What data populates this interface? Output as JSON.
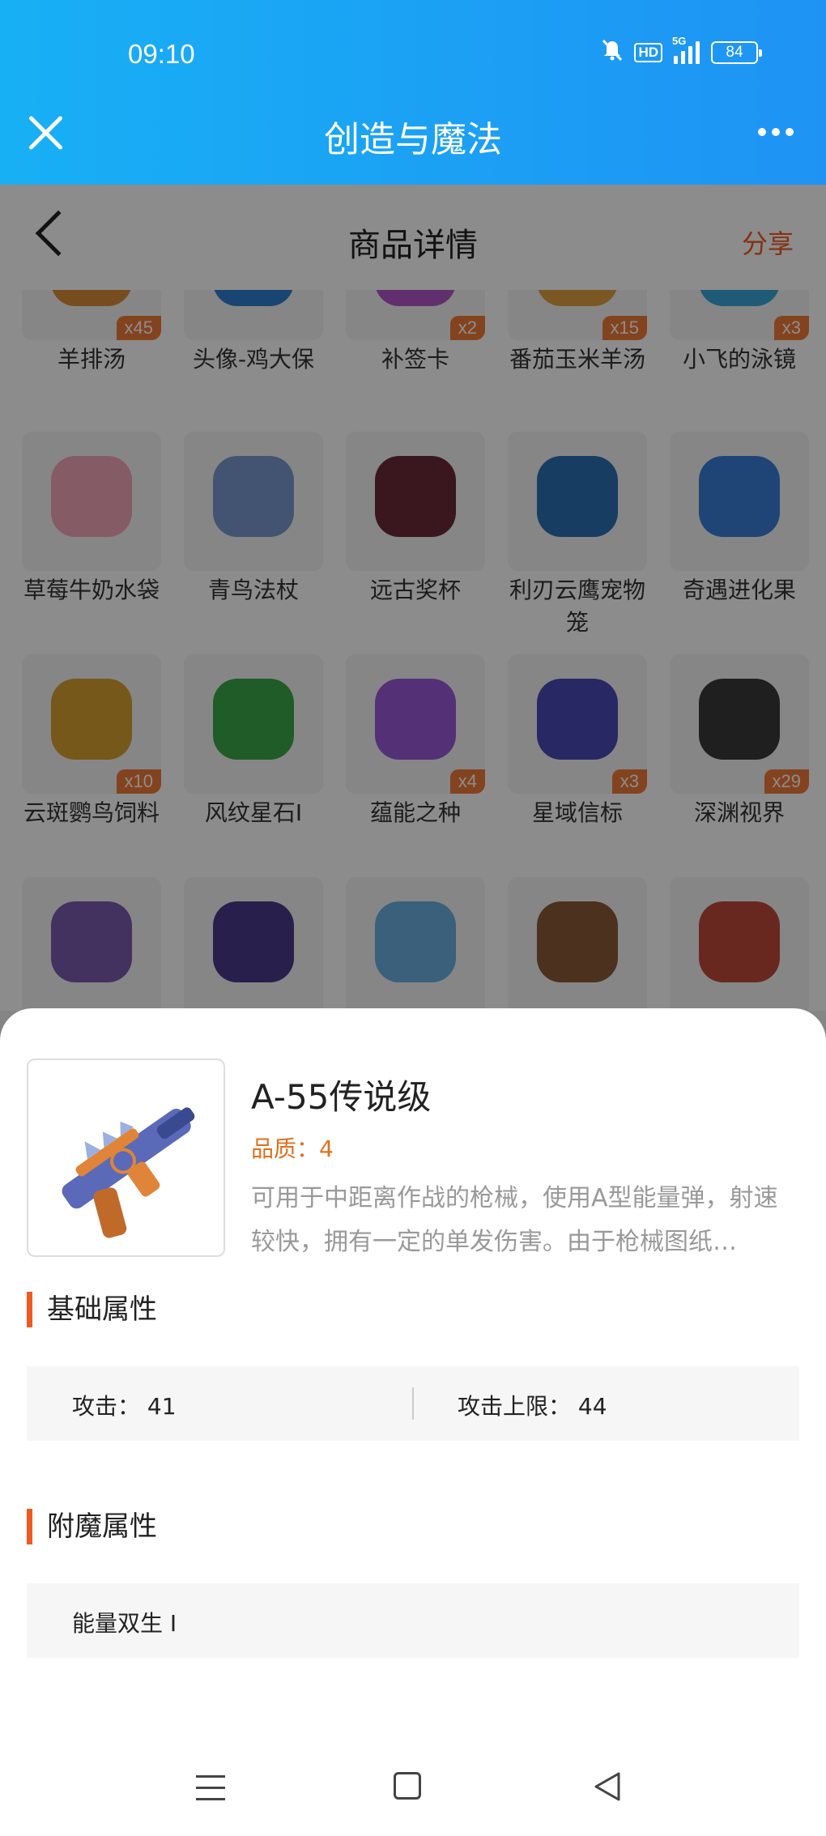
{
  "status_bar": {
    "time": "09:10",
    "hd": "HD",
    "network": "5G",
    "battery": "84"
  },
  "app_bar": {
    "title": "创造与魔法"
  },
  "page_header": {
    "title": "商品详情",
    "share": "分享"
  },
  "grid": {
    "items": [
      {
        "name": "羊排汤",
        "count": "x45",
        "color": "#d98b3a"
      },
      {
        "name": "头像-鸡大保",
        "count": "",
        "color": "#2e7fd0"
      },
      {
        "name": "补签卡",
        "count": "x2",
        "color": "#b357c9"
      },
      {
        "name": "番茄玉米羊汤",
        "count": "x15",
        "color": "#e0a040"
      },
      {
        "name": "小飞的泳镜",
        "count": "x3",
        "color": "#3aa6d8"
      },
      {
        "name": "草莓牛奶水袋",
        "count": "",
        "color": "#f3a6b8"
      },
      {
        "name": "青鸟法杖",
        "count": "",
        "color": "#7a9ad0"
      },
      {
        "name": "远古奖杯",
        "count": "",
        "color": "#6b2a3a"
      },
      {
        "name": "利刃云鹰宠物笼",
        "count": "",
        "color": "#2d6fb5"
      },
      {
        "name": "奇遇进化果",
        "count": "",
        "color": "#3a7dd8"
      },
      {
        "name": "云斑鹦鸟饲料",
        "count": "x10",
        "color": "#d8a030"
      },
      {
        "name": "风纹星石I",
        "count": "",
        "color": "#3aa84a"
      },
      {
        "name": "蕴能之种",
        "count": "x4",
        "color": "#9a5ad8"
      },
      {
        "name": "星域信标",
        "count": "x3",
        "color": "#4a4ab8"
      },
      {
        "name": "深渊视界",
        "count": "x29",
        "color": "#3a3a3a"
      },
      {
        "name": "",
        "count": "",
        "color": "#7a5ab0"
      },
      {
        "name": "",
        "count": "",
        "color": "#4a3a8a"
      },
      {
        "name": "",
        "count": "",
        "color": "#6ab0e0"
      },
      {
        "name": "",
        "count": "",
        "color": "#8a5a3a"
      },
      {
        "name": "",
        "count": "",
        "color": "#c04a3a"
      }
    ]
  },
  "detail": {
    "name": "A-55传说级",
    "quality_label": "品质：",
    "quality_value": "4",
    "description": "可用于中距离作战的枪械，使用A型能量弹，射速较快，拥有一定的单发伤害。由于枪械图纸…",
    "base_attrs_title": "基础属性",
    "attack_label": "攻击：",
    "attack_value": "41",
    "attack_max_label": "攻击上限：",
    "attack_max_value": "44",
    "enchant_title": "附魔属性",
    "enchant_value": "能量双生 I"
  },
  "colors": {
    "accent": "#f05a22",
    "appbar": "#1e93f4",
    "quality": "#e0701e"
  }
}
